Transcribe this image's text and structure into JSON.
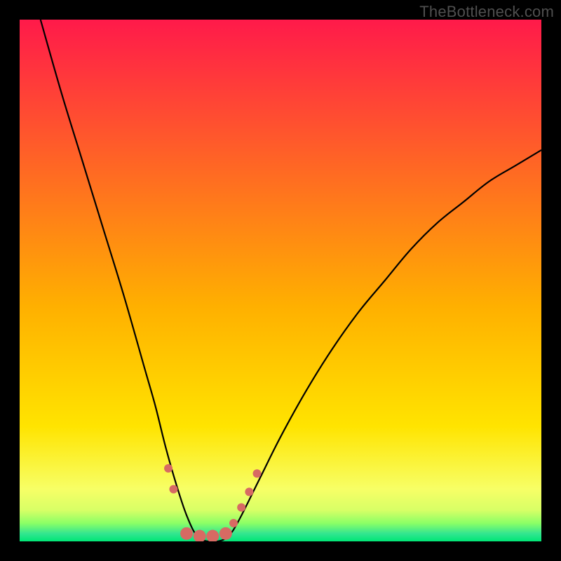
{
  "watermark": "TheBottleneck.com",
  "chart_data": {
    "type": "line",
    "title": "",
    "xlabel": "",
    "ylabel": "",
    "xlim": [
      0,
      100
    ],
    "ylim": [
      0,
      100
    ],
    "grid": false,
    "legend": false,
    "background_gradient": {
      "top_color": "#ff1a4a",
      "mid_color": "#ffe400",
      "bottom_color": "#00e676"
    },
    "series": [
      {
        "name": "bottleneck-curve",
        "color": "#000000",
        "x": [
          4,
          8,
          12,
          16,
          20,
          24,
          26,
          28,
          30,
          32,
          34,
          36,
          38,
          40,
          42,
          46,
          50,
          55,
          60,
          65,
          70,
          75,
          80,
          85,
          90,
          95,
          100
        ],
        "y": [
          100,
          86,
          73,
          60,
          47,
          33,
          26,
          18,
          11,
          5,
          1,
          0,
          0,
          1,
          4,
          12,
          20,
          29,
          37,
          44,
          50,
          56,
          61,
          65,
          69,
          72,
          75
        ]
      }
    ],
    "markers": {
      "name": "highlighted-points",
      "color": "#d76a63",
      "radius_small": 6,
      "radius_large": 9,
      "points": [
        {
          "x": 28.5,
          "y": 14,
          "r": "small"
        },
        {
          "x": 29.5,
          "y": 10,
          "r": "small"
        },
        {
          "x": 32.0,
          "y": 1.5,
          "r": "large"
        },
        {
          "x": 34.5,
          "y": 1.0,
          "r": "large"
        },
        {
          "x": 37.0,
          "y": 1.0,
          "r": "large"
        },
        {
          "x": 39.5,
          "y": 1.5,
          "r": "large"
        },
        {
          "x": 41.0,
          "y": 3.5,
          "r": "small"
        },
        {
          "x": 42.5,
          "y": 6.5,
          "r": "small"
        },
        {
          "x": 44.0,
          "y": 9.5,
          "r": "small"
        },
        {
          "x": 45.5,
          "y": 13.0,
          "r": "small"
        }
      ]
    }
  }
}
